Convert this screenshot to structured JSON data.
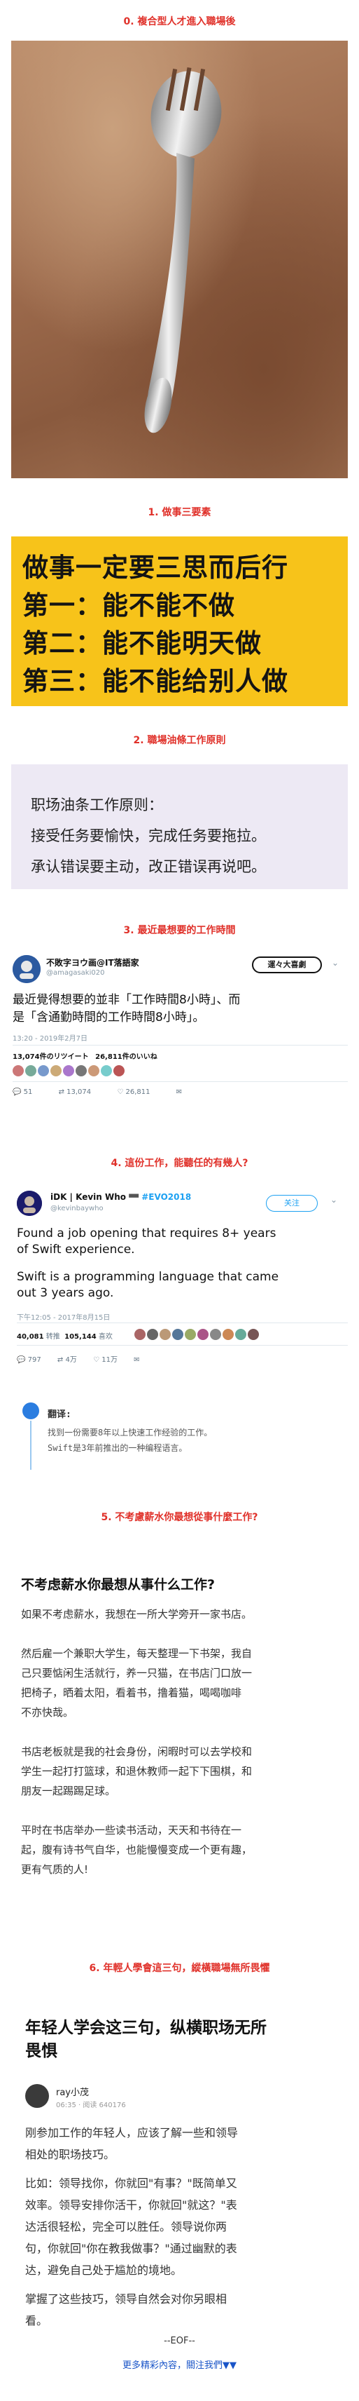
{
  "sections": {
    "s0": "0. 複合型人才進入職場後",
    "s1": "1. 做事三要素",
    "s2": "2. 職場油條工作原則",
    "s3": "3. 最近最想要的工作時間",
    "s4": "4. 這份工作，能聽任的有幾人?",
    "s5": "5. 不考慮薪水你最想從事什麼工作?",
    "s6": "6. 年輕人學會這三句，縱橫職場無所畏懼"
  },
  "banner": {
    "line1": "做事一定要三思而后行",
    "line2": "第一：能不能不做",
    "line3": "第二：能不能明天做",
    "line4": "第三：能不能给别人做"
  },
  "principle": {
    "line1": "职场油条工作原则：",
    "line2": "接受任务要愉快，完成任务要拖拉。",
    "line3": "承认错误要主动，改正错误再说吧。"
  },
  "tweet1": {
    "name": "不敗字ヨウ画@IT落語家",
    "handle": "@amagasaki020",
    "badge": "運々大喜劇",
    "text1": "最近覺得想要的並非「工作時間8小時」、而",
    "text2": "是「含通勤時間的工作時間8小時」。",
    "date": "13:20 - 2019年2月7日",
    "retweets_label": "13,074件のリツイート",
    "likes_label": "26,811件のいいね",
    "replies": "51",
    "rts": "13,074",
    "likes": "26,811"
  },
  "tweet2": {
    "name": "iDK | Kevin Who",
    "tag": "#EVO2018",
    "handle": "@kevinbaywho",
    "follow": "关注",
    "text1": "Found a job opening that requires 8+ years",
    "text2": "of Swift experience.",
    "text3": "Swift is a programming language that came",
    "text4": "out 3 years ago.",
    "date": "下午12:05 - 2017年8月15日",
    "retweets": "40,081",
    "retweets_word": "转推",
    "likes": "105,144",
    "likes_word": "喜欢",
    "replies": "797",
    "rts": "4万",
    "hearts": "11万"
  },
  "reply": {
    "label": "翻译:",
    "line1": "找到一份需要8年以上快速工作经验的工作。",
    "line2": "Swift是3年前推出的一种编程语言。"
  },
  "article1": {
    "title": "不考虑薪水你最想从事什么工作?",
    "p1": [
      "如果不考虑薪水，我想在一所大学旁开一家书店。"
    ],
    "p2": [
      "然后雇一个兼职大学生，每天整理一下书架，我自",
      "己只要惦闲生活就行，养一只猫，在书店门口放一",
      "把椅子，晒着太阳，看着书，撸着猫，喝喝咖啡",
      "不亦快哉。"
    ],
    "p3": [
      "书店老板就是我的社会身份，闲暇时可以去学校和",
      "学生一起打打篮球，和退休教师一起下下围棋，和",
      "朋友一起踢踢足球。"
    ],
    "p4": [
      "平时在书店举办一些读书活动，天天和书待在一",
      "起，腹有诗书气自华，也能慢慢变成一个更有趣，",
      "更有气质的人!"
    ]
  },
  "article2": {
    "title1": "年轻人学会这三句，纵横职场无所",
    "title2": "畏惧",
    "author": "ray小茂",
    "meta": "06:35 · 阅读 640176",
    "p1": [
      "刚参加工作的年轻人，应该了解一些和领导",
      "相处的职场技巧。"
    ],
    "p2": [
      "比如：领导找你，你就回\"有事？\"既简单又",
      "效率。领导安排你活干，你就回\"就这？\"表",
      "达活很轻松，完全可以胜任。领导说你两",
      "句，你就回\"你在教我做事？\"通过幽默的表",
      "达，避免自己处于尴尬的境地。"
    ],
    "p3": [
      "掌握了这些技巧，领导自然会对你另眼相",
      "看。"
    ]
  },
  "footer": {
    "eof": "--EOF--",
    "more": "更多精彩內容，關注我們▼▼"
  },
  "colors": {
    "section_red": "#e0312a",
    "banner_yellow": "#f7c31a",
    "principle_bg": "#ede9f4",
    "link_blue": "#1a55c8"
  }
}
